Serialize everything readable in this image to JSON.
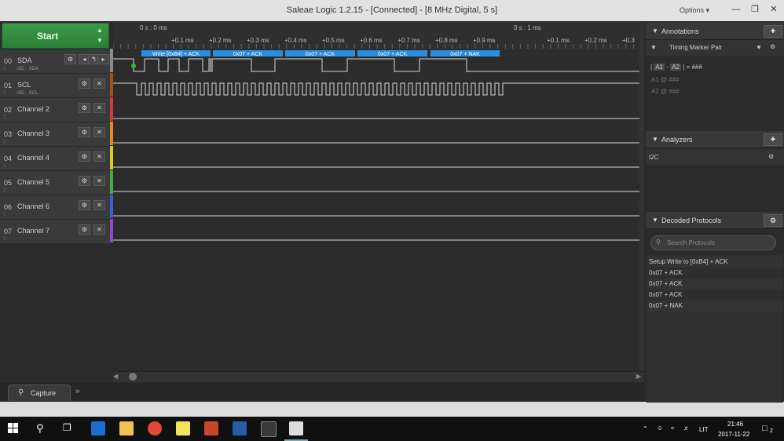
{
  "window": {
    "title": "Saleae Logic 1.2.15 - [Connected] - [8 MHz Digital, 5 s]",
    "options_label": "Options ▾"
  },
  "capture": {
    "start_label": "Start",
    "tab_label": "Capture"
  },
  "channels": [
    {
      "num": "00",
      "name": "SDA",
      "sub": "I2C - SDA",
      "color": "#8a8a8a"
    },
    {
      "num": "01",
      "name": "SCL",
      "sub": "I2C - SCL",
      "color": "#a0521d"
    },
    {
      "num": "02",
      "name": "Channel 2",
      "sub": "",
      "color": "#d23a3a"
    },
    {
      "num": "03",
      "name": "Channel 3",
      "sub": "",
      "color": "#e08a2a"
    },
    {
      "num": "04",
      "name": "Channel 4",
      "sub": "",
      "color": "#e0c62a"
    },
    {
      "num": "05",
      "name": "Channel 5",
      "sub": "",
      "color": "#3fae3f"
    },
    {
      "num": "06",
      "name": "Channel 6",
      "sub": "",
      "color": "#3a5fd2"
    },
    {
      "num": "07",
      "name": "Channel 7",
      "sub": "",
      "color": "#9a44c8"
    }
  ],
  "ruler": {
    "top_left": "0 s : 0 ms",
    "top_right": "0 s : 1 ms",
    "ticks": [
      "+0.1 ms",
      "+0.2 ms",
      "+0.3 ms",
      "+0.4 ms",
      "+0.5 ms",
      "+0.6 ms",
      "+0.7 ms",
      "+0.8 ms",
      "+0.9 ms",
      "+0.1 ms",
      "+0.2 ms",
      "+0.3"
    ]
  },
  "decode_bubbles": [
    "Write [0xB4] + ACK",
    "0x07 + ACK",
    "0x07 + ACK",
    "0x07 + ACK",
    "0x07 + NAK"
  ],
  "annotations": {
    "title": "Annotations",
    "timing_label": "Timing Marker Pair",
    "a1": "A1",
    "a2": "A2",
    "eq": "= ###",
    "a1_row": "A1  @  ###",
    "a2_row": "A2  @  ###"
  },
  "analyzers": {
    "title": "Analyzers",
    "items": [
      "I2C"
    ]
  },
  "decoded": {
    "title": "Decoded Protocols",
    "search_placeholder": "Search Protocols",
    "items": [
      "Setup Write to [0xB4] + ACK",
      "0x07 + ACK",
      "0x07 + ACK",
      "0x07 + ACK",
      "0x07 + NAK"
    ]
  },
  "taskbar": {
    "time": "21:46",
    "date": "2017-11-22",
    "lang": "LIT",
    "notif_count": "2"
  },
  "colors": {
    "accent_green": "#2f8a3d",
    "bubble_blue": "#2a8de0",
    "signal": "#d8d8d8"
  }
}
